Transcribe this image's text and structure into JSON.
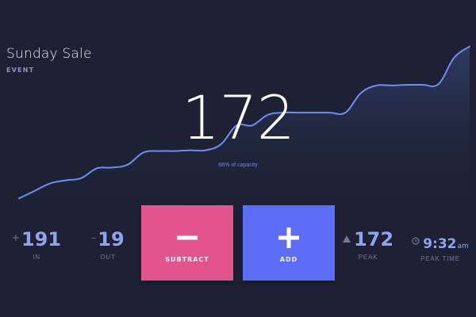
{
  "event": {
    "title": "Sunday Sale",
    "type": "EVENT"
  },
  "counter": {
    "current": "172",
    "capacity_text": "68% of capacity",
    "capacity_fraction": 0.68
  },
  "chart_data": {
    "type": "area",
    "title": "",
    "xlabel": "",
    "ylabel": "",
    "ylim": [
      0,
      240
    ],
    "grid": false,
    "legend": "none",
    "series": [
      {
        "values": [
          8,
          18,
          28,
          32,
          35,
          48,
          49,
          53,
          69,
          71,
          71,
          72,
          72,
          80,
          105,
          105,
          119,
          122,
          122,
          122,
          122,
          122,
          148,
          158,
          158,
          159,
          159,
          160,
          195,
          210
        ]
      }
    ]
  },
  "stats": {
    "in": {
      "prefix": "+",
      "value": "191",
      "label": "IN"
    },
    "out": {
      "prefix": "–",
      "value": "19",
      "label": "OUT"
    },
    "peak": {
      "value": "172",
      "label": "PEAK",
      "icon": "triangle-up-icon"
    },
    "peak_time": {
      "value": "9:32",
      "unit": "am",
      "label": "PEAK TIME",
      "icon": "clock-icon"
    }
  },
  "actions": {
    "subtract": {
      "label": "SUBTRACT",
      "icon": "minus-icon"
    },
    "add": {
      "label": "ADD",
      "icon": "plus-icon"
    }
  },
  "colors": {
    "background": "#1d2133",
    "line": "#6d8ff0",
    "area_top": "#2f3c67",
    "subtract": "#e2548e",
    "add": "#5b6ef5",
    "stat_value": "#8fa3f0"
  }
}
